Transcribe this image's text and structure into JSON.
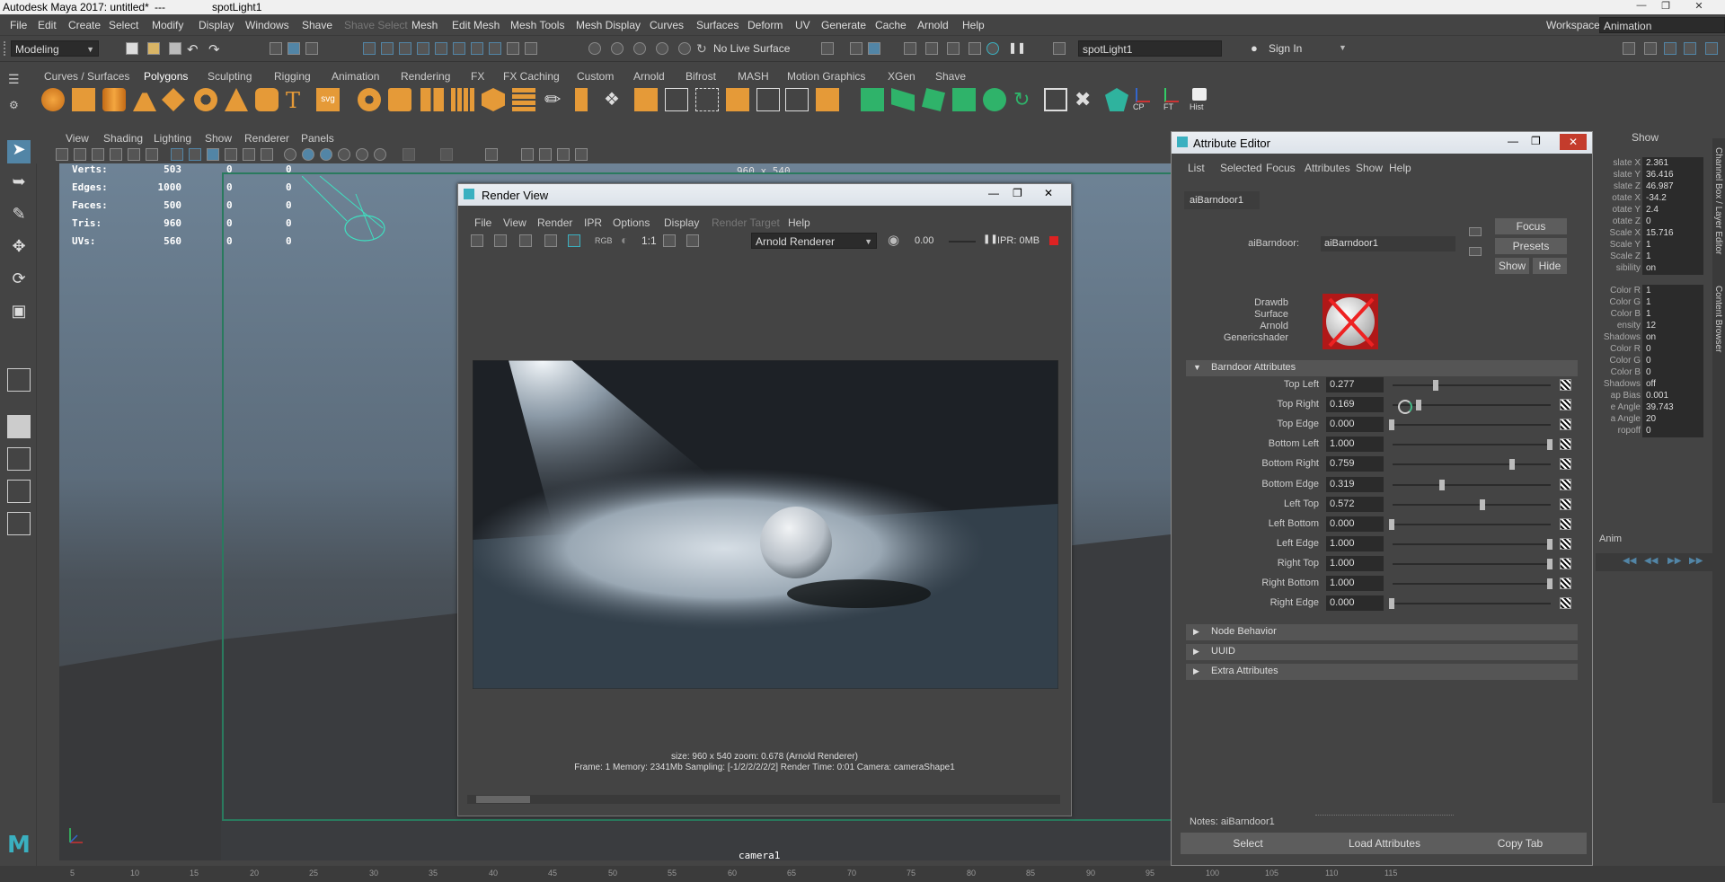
{
  "window": {
    "app_title": "Autodesk Maya 2017: untitled*",
    "separator": "---",
    "object": "spotLight1"
  },
  "menubar": [
    "File",
    "Edit",
    "Create",
    "Select",
    "Modify",
    "Display",
    "Windows",
    "Shave",
    "Shave Select",
    "Mesh",
    "Edit Mesh",
    "Mesh Tools",
    "Mesh Display",
    "Curves",
    "Surfaces",
    "Deform",
    "UV",
    "Generate",
    "Cache",
    "Arnold",
    "Help"
  ],
  "workspace": {
    "label": "Workspace :",
    "value": "Animation"
  },
  "statusline": {
    "mode": "Modeling",
    "live_surface": "No Live Surface",
    "selected_object": "spotLight1",
    "sign_in": "Sign In"
  },
  "shelf_tabs": [
    "Curves / Surfaces",
    "Polygons",
    "Sculpting",
    "Rigging",
    "Animation",
    "Rendering",
    "FX",
    "FX Caching",
    "Custom",
    "Arnold",
    "Bifrost",
    "MASH",
    "Motion Graphics",
    "XGen",
    "Shave"
  ],
  "shelf_icon_labels": {
    "cp": "CP",
    "ft": "FT",
    "hist": "Hist"
  },
  "viewport": {
    "menu": [
      "View",
      "Shading",
      "Lighting",
      "Show",
      "Renderer",
      "Panels"
    ],
    "resolution": "960 x 540",
    "camera": "camera1",
    "hud": [
      {
        "label": "Verts:",
        "v1": "503",
        "v2": "0",
        "v3": "0"
      },
      {
        "label": "Edges:",
        "v1": "1000",
        "v2": "0",
        "v3": "0"
      },
      {
        "label": "Faces:",
        "v1": "500",
        "v2": "0",
        "v3": "0"
      },
      {
        "label": "Tris:",
        "v1": "960",
        "v2": "0",
        "v3": "0"
      },
      {
        "label": "UVs:",
        "v1": "560",
        "v2": "0",
        "v3": "0"
      }
    ]
  },
  "render_view": {
    "title": "Render View",
    "menu": [
      "File",
      "View",
      "Render",
      "IPR",
      "Options",
      "Display",
      "Render Target",
      "Help"
    ],
    "ratio": "1:1",
    "renderer": "Arnold Renderer",
    "exposure": "0.00",
    "ipr": "IPR: 0MB",
    "rgb": "RGB",
    "status1": "size: 960 x 540  zoom: 0.678     (Arnold Renderer)",
    "status2": "Frame: 1     Memory: 2341Mb     Sampling: [-1/2/2/2/2/2]     Render Time: 0:01     Camera: cameraShape1"
  },
  "attribute_editor": {
    "title": "Attribute Editor",
    "menu": [
      "List",
      "Selected",
      "Focus",
      "Attributes",
      "Show",
      "Help"
    ],
    "node_tab": "aiBarndoor1",
    "node_label": "aiBarndoor:",
    "node_value": "aiBarndoor1",
    "buttons": {
      "focus": "Focus",
      "presets": "Presets",
      "show": "Show",
      "hide": "Hide"
    },
    "swatch_labels": [
      "Drawdb",
      "Surface",
      "Arnold",
      "Genericshader"
    ],
    "section_title": "Barndoor Attributes",
    "attributes": [
      {
        "label": "Top Left",
        "value": "0.277",
        "fraction": 0.277
      },
      {
        "label": "Top Right",
        "value": "0.169",
        "fraction": 0.169
      },
      {
        "label": "Top Edge",
        "value": "0.000",
        "fraction": 0.0
      },
      {
        "label": "Bottom Left",
        "value": "1.000",
        "fraction": 1.0
      },
      {
        "label": "Bottom Right",
        "value": "0.759",
        "fraction": 0.759
      },
      {
        "label": "Bottom Edge",
        "value": "0.319",
        "fraction": 0.319
      },
      {
        "label": "Left Top",
        "value": "0.572",
        "fraction": 0.572
      },
      {
        "label": "Left Bottom",
        "value": "0.000",
        "fraction": 0.0
      },
      {
        "label": "Left Edge",
        "value": "1.000",
        "fraction": 1.0
      },
      {
        "label": "Right Top",
        "value": "1.000",
        "fraction": 1.0
      },
      {
        "label": "Right Bottom",
        "value": "1.000",
        "fraction": 1.0
      },
      {
        "label": "Right Edge",
        "value": "0.000",
        "fraction": 0.0
      }
    ],
    "collapsed_sections": [
      "Node Behavior",
      "UUID",
      "Extra Attributes"
    ],
    "notes": "Notes:  aiBarndoor1",
    "footer": {
      "select": "Select",
      "load": "Load Attributes",
      "copy": "Copy Tab"
    }
  },
  "channel_box": {
    "show_label": "Show",
    "anim_label": "Anim",
    "side_tabs": "Channel Box / Layer Editor",
    "side_tabs2": "Content Browser",
    "rows": [
      {
        "label": "slate X",
        "value": "2.361"
      },
      {
        "label": "slate Y",
        "value": "36.416"
      },
      {
        "label": "slate Z",
        "value": "46.987"
      },
      {
        "label": "otate X",
        "value": "-34.2"
      },
      {
        "label": "otate Y",
        "value": "2.4"
      },
      {
        "label": "otate Z",
        "value": "0"
      },
      {
        "label": "Scale X",
        "value": "15.716"
      },
      {
        "label": "Scale Y",
        "value": "1"
      },
      {
        "label": "Scale Z",
        "value": "1"
      },
      {
        "label": "sibility",
        "value": "on"
      },
      {
        "label": "Color R",
        "value": "1"
      },
      {
        "label": "Color G",
        "value": "1"
      },
      {
        "label": "Color B",
        "value": "1"
      },
      {
        "label": "ensity",
        "value": "12"
      },
      {
        "label": "Shadows",
        "value": "on"
      },
      {
        "label": "Color R",
        "value": "0"
      },
      {
        "label": "Color G",
        "value": "0"
      },
      {
        "label": "Color B",
        "value": "0"
      },
      {
        "label": "Shadows",
        "value": "off"
      },
      {
        "label": "ap Bias",
        "value": "0.001"
      },
      {
        "label": "e Angle",
        "value": "39.743"
      },
      {
        "label": "a Angle",
        "value": "20"
      },
      {
        "label": "ropoff",
        "value": "0"
      }
    ]
  },
  "timeline_ticks": [
    "5",
    "10",
    "15",
    "20",
    "25",
    "30",
    "35",
    "40",
    "45",
    "50",
    "55",
    "60",
    "65",
    "70",
    "75",
    "80",
    "85",
    "90",
    "95",
    "100",
    "105",
    "110",
    "115"
  ],
  "colors": {
    "accent": "#5285a6",
    "selection_frame": "#2a7a5e",
    "panel": "#444444"
  }
}
